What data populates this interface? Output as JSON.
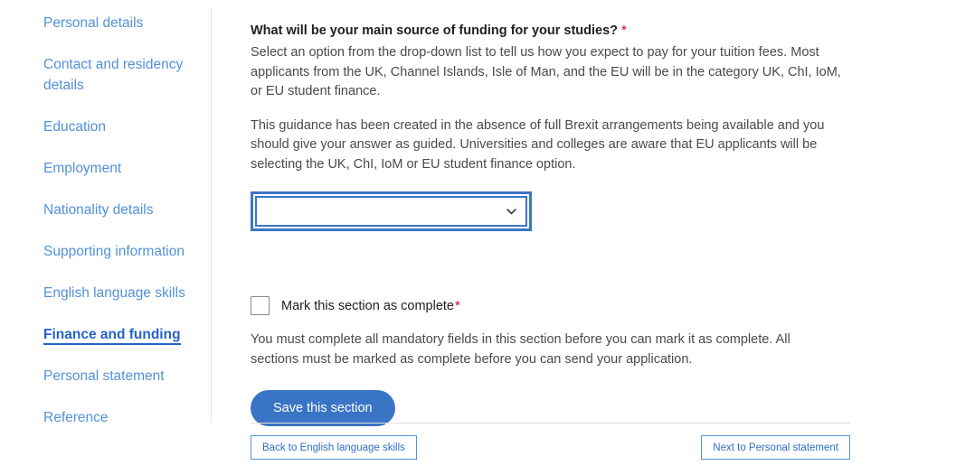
{
  "sidebar": {
    "items": [
      {
        "label": "Personal details",
        "active": false
      },
      {
        "label": "Contact and residency details",
        "active": false
      },
      {
        "label": "Education",
        "active": false
      },
      {
        "label": "Employment",
        "active": false
      },
      {
        "label": "Nationality details",
        "active": false
      },
      {
        "label": "Supporting information",
        "active": false
      },
      {
        "label": "English language skills",
        "active": false
      },
      {
        "label": "Finance and funding",
        "active": true
      },
      {
        "label": "Personal statement",
        "active": false
      },
      {
        "label": "Reference",
        "active": false
      }
    ]
  },
  "main": {
    "question": "What will be your main source of funding for your studies?",
    "required_marker": "*",
    "description_1": "Select an option from the drop-down list to tell us how you expect to pay for your tuition fees. Most applicants from the UK, Channel Islands, Isle of Man, and the EU will be in the category UK, ChI, IoM, or EU student finance.",
    "description_2": "This guidance has been created in the absence of full Brexit arrangements being available and you should give your answer as guided. Universities and colleges are aware that EU applicants will be selecting the UK, ChI, IoM or EU student finance option.",
    "funding_select": {
      "value": "",
      "focused": true
    },
    "complete_checkbox": {
      "label": "Mark this section as complete",
      "required_marker": "*",
      "checked": false
    },
    "helper_text": "You must complete all mandatory fields in this section before you can mark it as complete. All sections must be marked as complete before you can send your application.",
    "save_label": "Save this section"
  },
  "footer": {
    "back_label": "Back to English language skills",
    "next_label": "Next to Personal statement"
  },
  "colors": {
    "link_blue": "#5291d8",
    "active_blue": "#2463c7",
    "button_blue": "#3a74c4",
    "focus_blue": "#3b76c4",
    "required_red": "#d0021b",
    "body_text": "#4a4a4a",
    "heading_text": "#1f1f1f"
  }
}
